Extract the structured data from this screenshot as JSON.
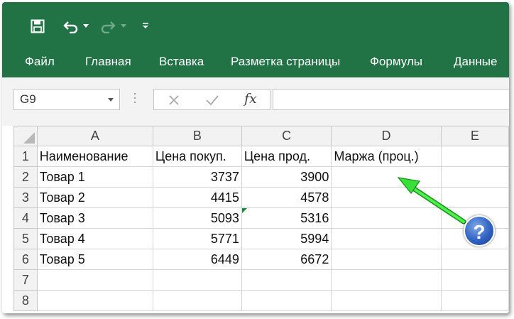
{
  "qat": {
    "save_icon": "save-icon",
    "undo_icon": "undo-icon",
    "redo_icon": "redo-icon",
    "customize_icon": "customize-qat-icon"
  },
  "tabs": [
    "Файл",
    "Главная",
    "Вставка",
    "Разметка страницы",
    "Формулы",
    "Данные"
  ],
  "formula_bar": {
    "name_box": "G9",
    "fx": "fx",
    "value": ""
  },
  "columns": [
    "A",
    "B",
    "C",
    "D",
    "E"
  ],
  "rows": [
    {
      "num": "1",
      "cells": [
        "Наименование",
        "Цена покуп.",
        "Цена прод.",
        "Маржа (проц.)",
        ""
      ]
    },
    {
      "num": "2",
      "cells": [
        "Товар 1",
        "3737",
        "3900",
        "",
        ""
      ]
    },
    {
      "num": "3",
      "cells": [
        "Товар 2",
        "4415",
        "4578",
        "",
        ""
      ]
    },
    {
      "num": "4",
      "cells": [
        "Товар 3",
        "5093",
        "5316",
        "",
        ""
      ]
    },
    {
      "num": "5",
      "cells": [
        "Товар 4",
        "5771",
        "5994",
        "",
        ""
      ]
    },
    {
      "num": "6",
      "cells": [
        "Товар 5",
        "6449",
        "6672",
        "",
        ""
      ]
    },
    {
      "num": "7",
      "cells": [
        "",
        "",
        "",
        "",
        ""
      ]
    },
    {
      "num": "8",
      "cells": [
        "",
        "",
        "",
        "",
        ""
      ]
    }
  ],
  "annotation": {
    "help_symbol": "?",
    "arrow_color": "#33dd33",
    "badge_color": "#2f62c2"
  },
  "colors": {
    "ribbon": "#217346",
    "grid_line": "#d4d4d4",
    "header_bg": "#f2f2f2"
  }
}
